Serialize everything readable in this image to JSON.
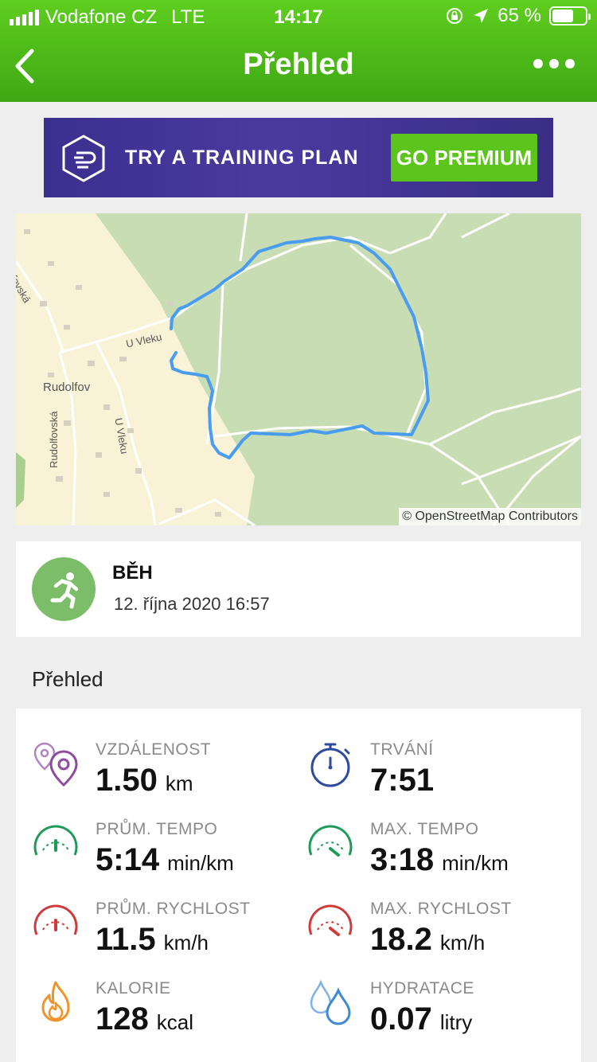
{
  "status_bar": {
    "carrier": "Vodafone CZ",
    "network": "LTE",
    "time": "14:17",
    "battery": "65 %",
    "battery_level": 0.65
  },
  "nav": {
    "title": "Přehled"
  },
  "banner": {
    "text": "TRY A TRAINING PLAN",
    "button": "GO PREMIUM"
  },
  "map": {
    "attribution": "© OpenStreetMap Contributors",
    "labels": {
      "village": "Rudolfov",
      "street1": "U Vleku",
      "street2": "U Vleku",
      "street3": "Rudolfovská",
      "street4": "dolfovská"
    }
  },
  "activity": {
    "name": "BĚH",
    "datetime": "12. října 2020 16:57"
  },
  "section_title": "Přehled",
  "stats": [
    {
      "label": "VZDÁLENOST",
      "value": "1.50",
      "unit": "km",
      "icon": "map-pins-icon",
      "color": "#8e4a9e"
    },
    {
      "label": "TRVÁNÍ",
      "value": "7:51",
      "unit": "",
      "icon": "stopwatch-icon",
      "color": "#2f4a9e"
    },
    {
      "label": "PRŮM. TEMPO",
      "value": "5:14",
      "unit": "min/km",
      "icon": "gauge-icon",
      "color": "#1f9a5a"
    },
    {
      "label": "MAX. TEMPO",
      "value": "3:18",
      "unit": "min/km",
      "icon": "gauge-icon",
      "color": "#1f9a5a"
    },
    {
      "label": "PRŮM. RYCHLOST",
      "value": "11.5",
      "unit": "km/h",
      "icon": "gauge-icon",
      "color": "#d03a3a"
    },
    {
      "label": "MAX. RYCHLOST",
      "value": "18.2",
      "unit": "km/h",
      "icon": "gauge-icon",
      "color": "#d03a3a"
    },
    {
      "label": "KALORIE",
      "value": "128",
      "unit": "kcal",
      "icon": "flame-icon",
      "color": "#f0932b"
    },
    {
      "label": "HYDRATACE",
      "value": "0.07",
      "unit": "litry",
      "icon": "water-drops-icon",
      "color": "#3f8ad0"
    }
  ]
}
